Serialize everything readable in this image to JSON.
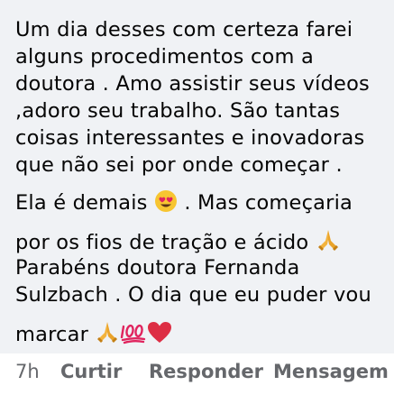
{
  "comment": {
    "lines": [
      "Um dia desses com certeza farei",
      "alguns procedimentos com a",
      "doutora . Amo assistir seus vídeos",
      ",adoro seu trabalho. São tantas",
      "coisas interessantes e inovadoras",
      "que não sei por onde começar ."
    ],
    "line7_before": "Ela é demais ",
    "line7_after": " . Mas começaria",
    "line8_before": "por os fios de tração e ácido ",
    "line9": "Parabéns doutora Fernanda",
    "line10": "Sulzbach . O dia que eu puder vou",
    "line11_before": "marcar "
  },
  "actions": {
    "time": "7h",
    "like": "Curtir",
    "reply": "Responder",
    "message": "Mensagem"
  },
  "icons": [
    "heart-eyes-emoji",
    "praying-hands-emoji",
    "hundred-points-emoji",
    "red-heart-emoji"
  ]
}
